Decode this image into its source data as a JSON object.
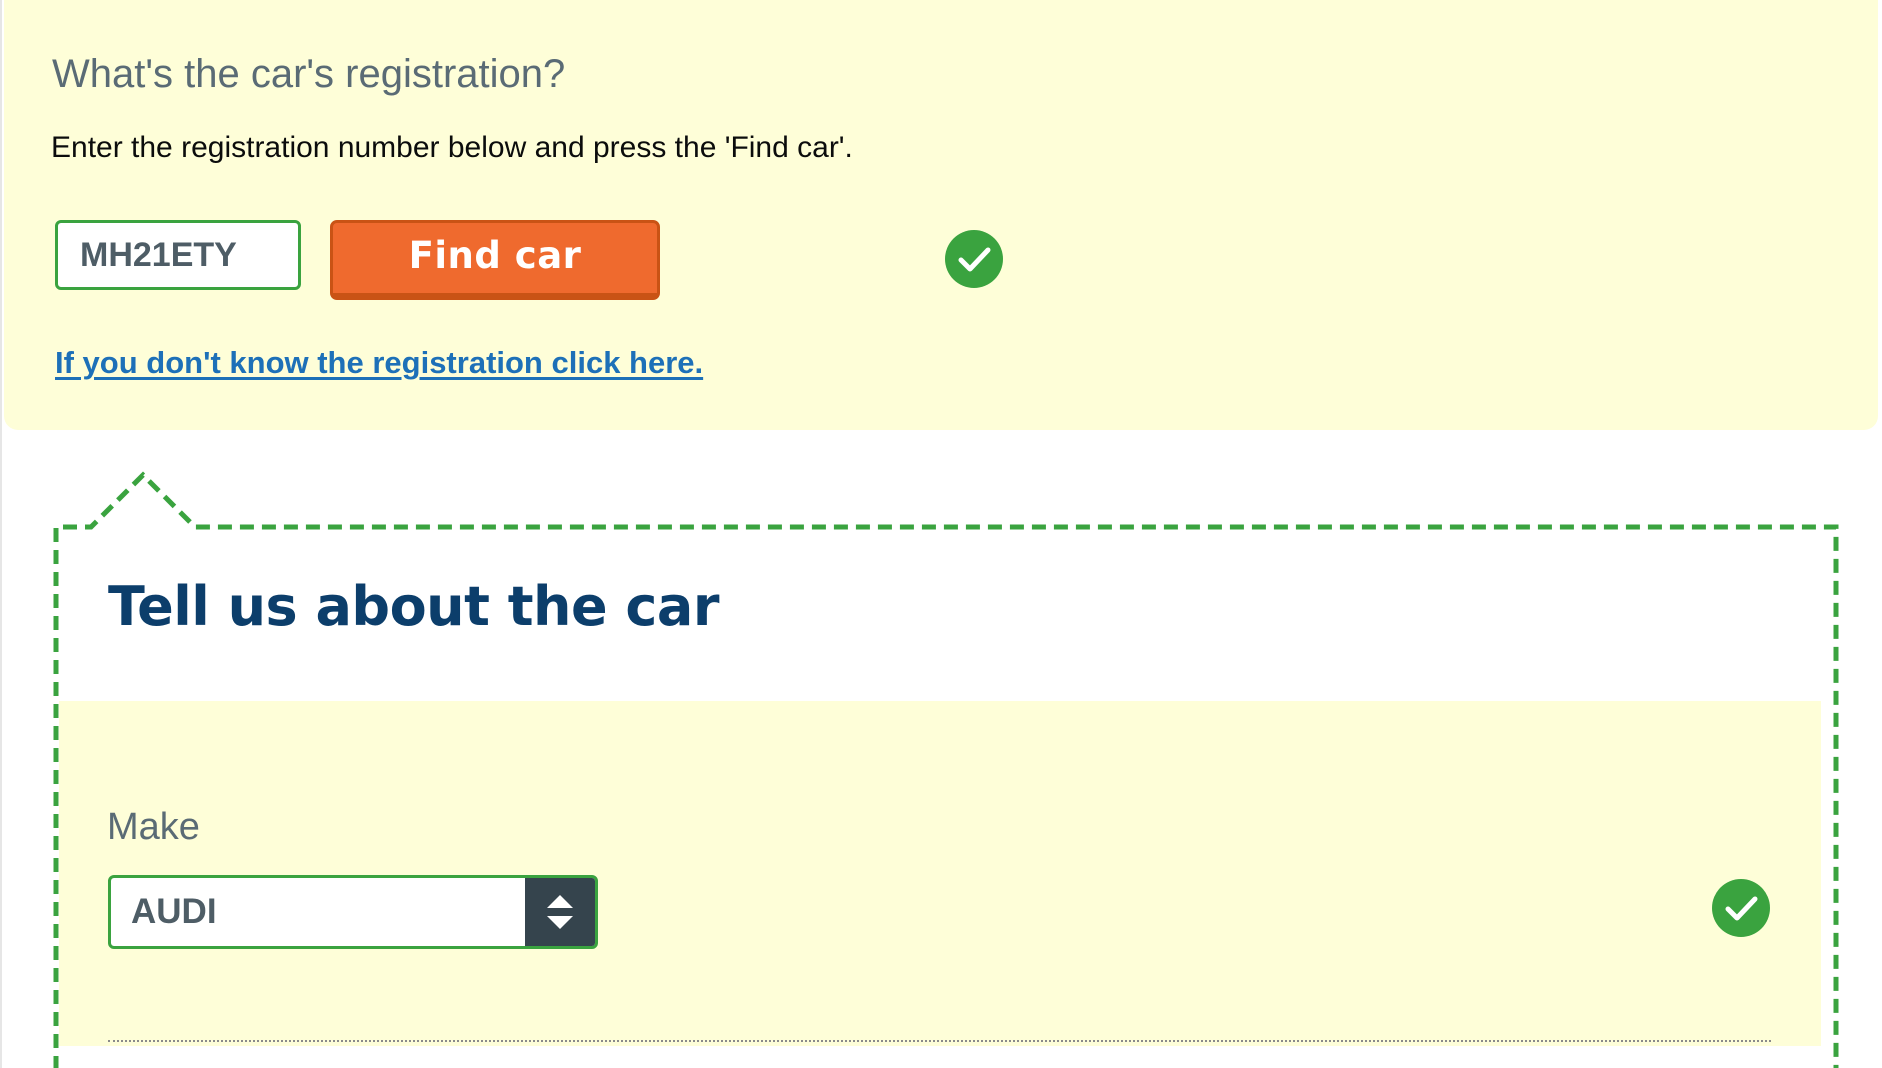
{
  "registration": {
    "question": "What's the car's registration?",
    "instruction": "Enter the registration number below and press the 'Find car'.",
    "input_value": "MH21ETY",
    "find_button_label": "Find car",
    "status_icon": "check-circle-icon",
    "help_link": "If you don't know the registration click here."
  },
  "car_details": {
    "title": "Tell us about the car",
    "make": {
      "label": "Make",
      "selected": "AUDI",
      "status_icon": "check-circle-icon"
    }
  },
  "colors": {
    "panel_background": "#fefed8",
    "accent_green": "#3aa33f",
    "button_orange": "#ef6a2e",
    "link_blue": "#1d70b8",
    "heading_navy": "#0c3e6b",
    "label_grey": "#5a6b75",
    "select_arrow_bg": "#35444d"
  }
}
